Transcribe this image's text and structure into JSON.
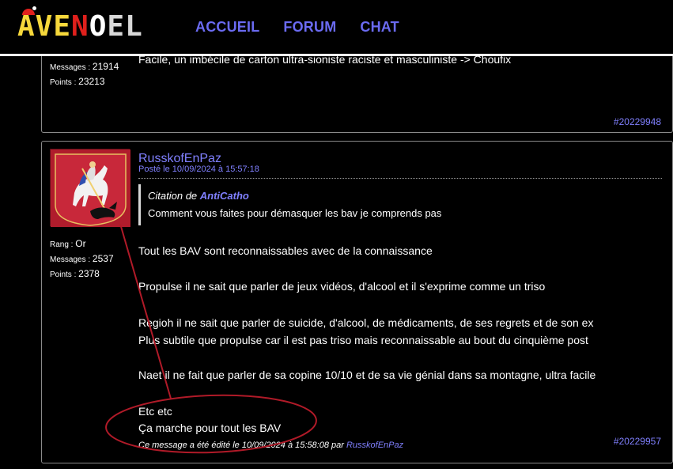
{
  "header": {
    "logo_parts": [
      "AVE",
      "N",
      "O",
      "EL"
    ],
    "nav": [
      "ACCUEIL",
      "FORUM",
      "CHAT"
    ]
  },
  "post1": {
    "partial_text": "Facile, un imbécile de carton ultra-sioniste raciste et masculiniste -> Choufix",
    "messages_label": "Messages",
    "messages": "21914",
    "points_label": "Points",
    "points": "23213",
    "id": "#20229948"
  },
  "post2": {
    "author": "RusskofEnPaz",
    "posted": "Posté le 10/09/2024 à 15:57:18",
    "rank_label": "Rang",
    "rank": "Or",
    "messages_label": "Messages",
    "messages": "2537",
    "points_label": "Points",
    "points": "2378",
    "quote": {
      "prefix": "Citation de ",
      "author": "AntiCatho",
      "text": "Comment vous faites pour démasquer les bav je comprends pas"
    },
    "lines": [
      "Tout les BAV sont reconnaissables avec de la connaissance",
      "Propulse il ne sait que parler de jeux vidéos, d'alcool et il s'exprime comme un triso",
      "Regioh il ne sait que parler de suicide, d'alcool, de médicaments, de ses regrets et de son ex",
      "Plus subtile que propulse car il est pas triso mais reconnaissable au bout du cinquième post",
      "Naet il ne fait que parler de sa copine 10/10 et de sa vie génial dans sa montagne, ultra facile",
      "Etc etc",
      "Ça marche pour tout les BAV"
    ],
    "edited_prefix": "Ce message a été édité le 10/09/2024 à 15:58:08 par ",
    "edited_by": "RusskofEnPaz",
    "id": "#20229957"
  },
  "colors": {
    "link": "#8080ff",
    "annotation": "#b01a28",
    "avatar_bg": "#b01c2c"
  },
  "icons": [
    "moscow-coat-of-arms-avatar",
    "santa-hat-icon"
  ]
}
